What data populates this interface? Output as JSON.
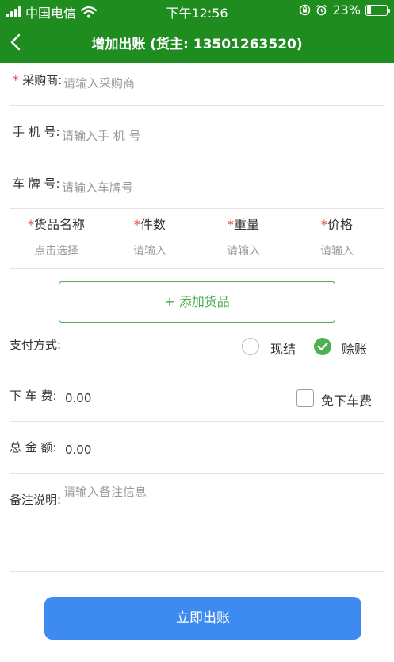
{
  "status": {
    "carrier": "中国电信",
    "time": "下午12:56",
    "battery_percent": "23%",
    "battery_level": 0.23
  },
  "nav": {
    "title": "增加出账 (货主: 13501263520)"
  },
  "form": {
    "buyer": {
      "required_mark": "*",
      "label": "采购商:",
      "placeholder": "请输入采购商"
    },
    "phone": {
      "label": "手 机 号:",
      "placeholder": "请输入手 机 号"
    },
    "plate": {
      "label": "车 牌 号:",
      "placeholder": "请输入车牌号"
    },
    "goods": {
      "columns": [
        {
          "required_mark": "*",
          "label": "货品名称",
          "placeholder": "点击选择"
        },
        {
          "required_mark": "*",
          "label": "件数",
          "placeholder": "请输入"
        },
        {
          "required_mark": "*",
          "label": "重量",
          "placeholder": "请输入"
        },
        {
          "required_mark": "*",
          "label": "价格",
          "placeholder": "请输入"
        }
      ],
      "add_label": "+ 添加货品"
    },
    "payment": {
      "label": "支付方式:",
      "options": [
        {
          "label": "现结",
          "selected": false
        },
        {
          "label": "赊账",
          "selected": true
        }
      ]
    },
    "unload_fee": {
      "label": "下 车 费:",
      "value": "0.00",
      "waive_label": "免下车费",
      "waive_checked": false
    },
    "total": {
      "label": "总 金 额:",
      "value": "0.00"
    },
    "remarks": {
      "label": "备注说明:",
      "placeholder": "请输入备注信息"
    }
  },
  "submit_label": "立即出账",
  "colors": {
    "header": "#1f8c20",
    "accent_green": "#4caf50",
    "button_blue": "#3d8bf0",
    "required_red": "#e53935"
  }
}
